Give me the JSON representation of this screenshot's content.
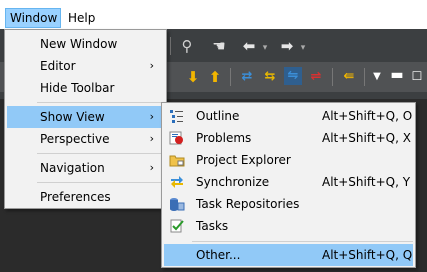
{
  "menubar": {
    "window_label": "Window",
    "help_label": "Help"
  },
  "window_menu": {
    "items": [
      {
        "label": "New Window",
        "has_submenu": false
      },
      {
        "label": "Editor",
        "has_submenu": true
      },
      {
        "label": "Hide Toolbar",
        "has_submenu": false
      },
      {
        "label": "Show View",
        "has_submenu": true,
        "active": true
      },
      {
        "label": "Perspective",
        "has_submenu": true
      },
      {
        "label": "Navigation",
        "has_submenu": true
      },
      {
        "label": "Preferences",
        "has_submenu": false
      }
    ],
    "arrow_glyph": "›"
  },
  "show_view_menu": {
    "items": [
      {
        "label": "Outline",
        "shortcut": "Alt+Shift+Q, O",
        "icon": "outline-icon"
      },
      {
        "label": "Problems",
        "shortcut": "Alt+Shift+Q, X",
        "icon": "problems-icon"
      },
      {
        "label": "Project Explorer",
        "shortcut": "",
        "icon": "project-explorer-icon"
      },
      {
        "label": "Synchronize",
        "shortcut": "Alt+Shift+Q, Y",
        "icon": "synchronize-icon"
      },
      {
        "label": "Task Repositories",
        "shortcut": "",
        "icon": "task-repositories-icon"
      },
      {
        "label": "Tasks",
        "shortcut": "",
        "icon": "tasks-icon"
      },
      {
        "label": "Other...",
        "shortcut": "Alt+Shift+Q, Q",
        "icon": "",
        "active": true
      }
    ]
  },
  "colors": {
    "highlight": "#91c9f7",
    "menu_bg": "#f2f2f2",
    "toolbar_dark": "#3c3f41"
  }
}
